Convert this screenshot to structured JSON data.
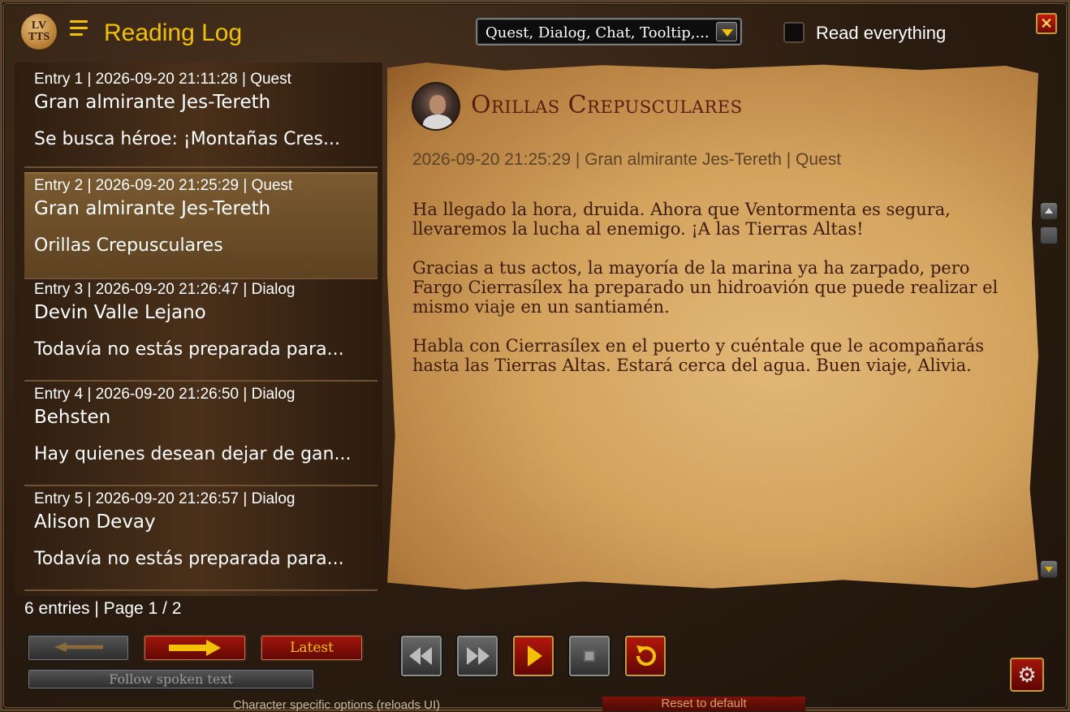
{
  "header": {
    "logo_text_top": "LV",
    "logo_text_bottom": "TTS",
    "title": "Reading Log",
    "filter_dropdown_value": "Quest, Dialog, Chat, Tooltip,...",
    "read_everything_label": "Read everything",
    "read_everything_checked": false,
    "close_label": "✕"
  },
  "entries": [
    {
      "meta": "Entry 1  |  2026-09-20 21:11:28  |  Quest",
      "speaker": "Gran almirante Jes-Tereth",
      "preview": "Se busca héroe: ¡Montañas Cres...",
      "selected": false
    },
    {
      "meta": "Entry 2  |  2026-09-20 21:25:29  |  Quest",
      "speaker": "Gran almirante Jes-Tereth",
      "preview": "Orillas Crepusculares",
      "selected": true
    },
    {
      "meta": "Entry 3  |  2026-09-20 21:26:47  |  Dialog",
      "speaker": "Devin Valle Lejano",
      "preview": "Todavía no estás preparada para...",
      "selected": false
    },
    {
      "meta": "Entry 4  |  2026-09-20 21:26:50  |  Dialog",
      "speaker": "Behsten",
      "preview": "Hay quienes desean dejar de gan...",
      "selected": false
    },
    {
      "meta": "Entry 5  |  2026-09-20 21:26:57  |  Dialog",
      "speaker": "Alison Devay",
      "preview": "Todavía no estás preparada para...",
      "selected": false
    }
  ],
  "detail": {
    "title": "Orillas Crepusculares",
    "meta": "2026-09-20 21:25:29  |  Gran almirante Jes-Tereth  |  Quest",
    "paragraphs": [
      "Ha llegado la hora, druida. Ahora que Ventormenta es segura, llevaremos la lucha al enemigo. ¡A las Tierras Altas!",
      "Gracias a tus actos, la mayoría de la marina ya ha zarpado, pero Fargo Cierrasílex ha preparado un hidroavión que puede realizar el mismo viaje en un santiamén.",
      "Habla con Cierrasílex en el puerto y cuéntale que le acompañarás hasta las Tierras Altas. Estará cerca del agua. Buen viaje, Alivia."
    ]
  },
  "footer": {
    "summary": "6 entries  |  Page 1 / 2",
    "latest_label": "Latest",
    "follow_label": "Follow spoken text",
    "underlay_text": "Character specific options (reloads UI)",
    "underlay_button": "Reset to default"
  },
  "icons": {
    "prev": "arrow-left-icon",
    "next": "arrow-right-icon",
    "rewind": "rewind-icon",
    "forward": "fast-forward-icon",
    "play": "play-icon",
    "stop": "stop-icon",
    "replay": "replay-icon",
    "settings": "gear-icon"
  },
  "colors": {
    "accent": "#f2c200",
    "title_red": "#5a1c0a",
    "button_red": "#a3160b"
  }
}
